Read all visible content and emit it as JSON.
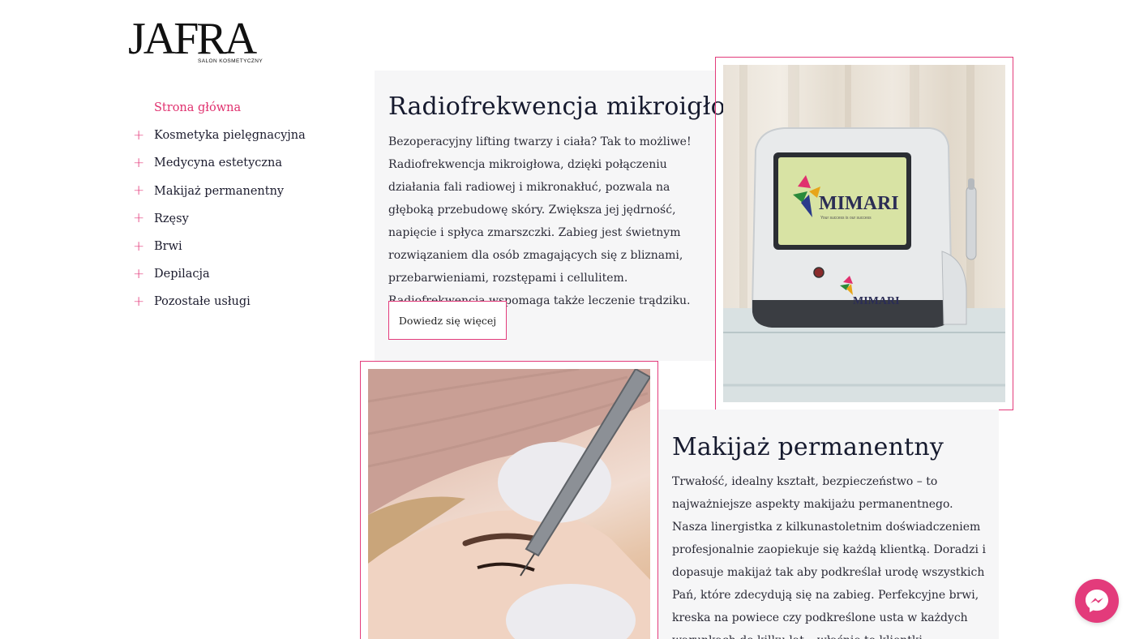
{
  "logo": {
    "word": "JAFRA",
    "subtitle": "SALON KOSMETYCZNY"
  },
  "nav": {
    "items": [
      {
        "label": "Strona główna",
        "active": true
      },
      {
        "label": "Kosmetyka pielęgnacyjna"
      },
      {
        "label": "Medycyna estetyczna"
      },
      {
        "label": "Makijaż permanentny"
      },
      {
        "label": "Rzęsy"
      },
      {
        "label": "Brwi"
      },
      {
        "label": "Depilacja"
      },
      {
        "label": "Pozostałe usługi"
      }
    ]
  },
  "section1": {
    "title": "Radiofrekwencja mikroigłowa",
    "text": "Bezoperacyjny lifting twarzy i ciała? Tak to możliwe! Radiofrekwencja mikroigłowa, dzięki połączeniu działania fali radiowej i mikronakłuć, pozwala na głęboką przebudowę skóry. Zwiększa jej jędrność, napięcie i spłyca zmarszczki. Zabieg jest świetnym rozwiązaniem dla osób zmagających się z bliznami, przebarwieniami, rozstępami i cellulitem. Radiofrekwencja wspomaga także leczenie trądziku.",
    "button": "Dowiedz się więcej",
    "image": {
      "brand": "MIMARI",
      "tagline": "Your success is our success"
    }
  },
  "section2": {
    "title": "Makijaż permanentny",
    "text": "Trwałość, idealny kształt, bezpieczeństwo – to najważniejsze aspekty makijażu permanentnego. Nasza linergistka z kilkunastoletnim doświadczeniem profesjonalnie zaopiekuje się każdą klientką. Doradzi i dopasuje makijaż tak aby podkreślał urodę wszystkich Pań, które zdecydują się na zabieg. Perfekcyjne brwi, kreska na powiece czy podkreślone usta w każdych warunkach do kilku lat – właśnie to klientki"
  },
  "colors": {
    "accent": "#e33b7b",
    "panel": "#f6f6f7",
    "text": "#161a2e"
  },
  "icons": {
    "nav_expand": "plus-icon",
    "chat": "messenger-icon"
  }
}
